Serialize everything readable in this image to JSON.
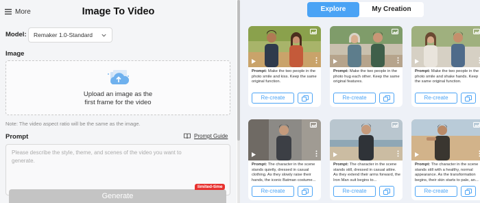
{
  "header": {
    "more_label": "More",
    "title": "Image To Video"
  },
  "model": {
    "label": "Model:",
    "selected": "Remaker 1.0-Standard"
  },
  "image": {
    "label": "Image",
    "upload_line1": "Upload an image as the",
    "upload_line2": "first frame for the video",
    "note": "Note: The video aspect ratio will be the same as the image."
  },
  "prompt": {
    "label": "Prompt",
    "guide_label": "Prompt Guide",
    "placeholder_line1": "Please describe the style, theme, and scenes of the video you want to",
    "placeholder_line2": "generate."
  },
  "generate": {
    "label": "Generate",
    "badge": "limited-time"
  },
  "tabs": [
    {
      "label": "Explore",
      "active": true
    },
    {
      "label": "My Creation",
      "active": false
    }
  ],
  "cards": [
    {
      "prefix": "Prompt:",
      "text": "Make the two people in the photo smile and kiss. Keep the same original function.",
      "recreate_label": "Re-create"
    },
    {
      "prefix": "Prompt:",
      "text": "Make the two people in the photo hug each other. Keep the same original features.",
      "recreate_label": "Re-create"
    },
    {
      "prefix": "Prompt:",
      "text": "Make the two people in the photo smile and shake hands. Keep the same original function.",
      "recreate_label": "Re-create"
    },
    {
      "prefix": "Prompt:",
      "text": "The character in the scene stands quietly, dressed in casual clothing. As they slowly raise their hands, the iconic Batman costume...",
      "recreate_label": "Re-create"
    },
    {
      "prefix": "Prompt:",
      "text": "The character in the scene stands still, dressed in casual attire. As they extend their arms forward, the Iron Man suit begins to...",
      "recreate_label": "Re-create"
    },
    {
      "prefix": "Prompt:",
      "text": "The character in the scene stands still with a healthy, normal appearance. As the transformation begins, their skin starts to pale, an...",
      "recreate_label": "Re-create"
    }
  ],
  "colors": {
    "accent": "#4aa3f5",
    "badge": "#e8322f",
    "generate_disabled": "#c4c4c4"
  }
}
